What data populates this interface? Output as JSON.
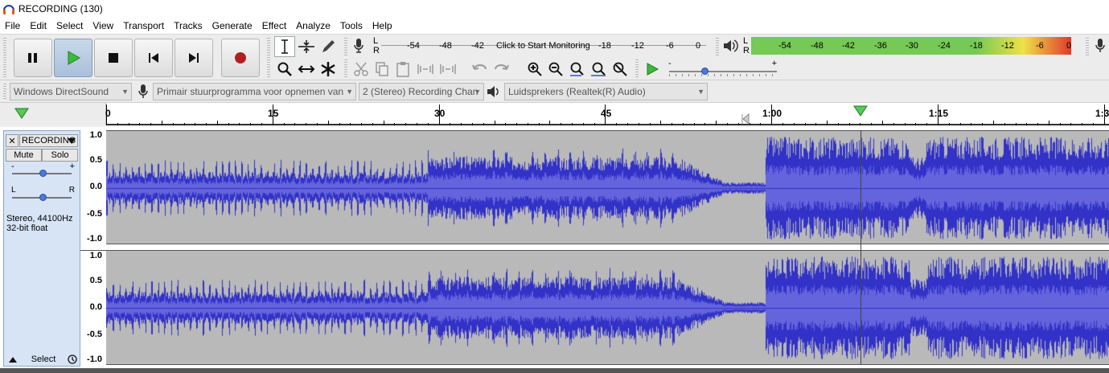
{
  "window": {
    "title": "RECORDING (130)"
  },
  "menu": [
    "File",
    "Edit",
    "Select",
    "View",
    "Transport",
    "Tracks",
    "Generate",
    "Effect",
    "Analyze",
    "Tools",
    "Help"
  ],
  "record_meter": {
    "l": "L",
    "r": "R",
    "ticks": [
      "-54",
      "-48",
      "-42",
      "-18",
      "-12",
      "-6",
      "0"
    ],
    "monitor_text": "Click to Start Monitoring"
  },
  "playback_meter": {
    "l": "L",
    "r": "R",
    "ticks": [
      "-54",
      "-48",
      "-42",
      "-36",
      "-30",
      "-24",
      "-18",
      "-12",
      "-6",
      "0"
    ]
  },
  "speed": {
    "minus": "-",
    "plus": "+"
  },
  "devices": {
    "host": "Windows DirectSound",
    "recording_device": "Primair stuurprogramma voor opnemen van",
    "channels": "2 (Stereo) Recording Chan",
    "playback_device": "Luidsprekers (Realtek(R) Audio)"
  },
  "ruler": {
    "labels": [
      "0",
      "15",
      "30",
      "45",
      "1:00",
      "1:15",
      "1:3"
    ]
  },
  "track": {
    "name": "RECORDING",
    "mute": "Mute",
    "solo": "Solo",
    "gain_minus": "-",
    "gain_plus": "+",
    "pan_l": "L",
    "pan_r": "R",
    "info1": "Stereo, 44100Hz",
    "info2": "32-bit float",
    "select": "Select",
    "scale": [
      "1.0",
      "0.5",
      "0.0",
      "-0.5",
      "-1.0"
    ]
  },
  "colors": {
    "wave": "#3232c8",
    "wave_rms": "#6464dc",
    "wave_bg": "#b9b9b9",
    "meter_green": "#6ec84c",
    "meter_yellow": "#f0e040",
    "meter_red": "#e03020"
  }
}
